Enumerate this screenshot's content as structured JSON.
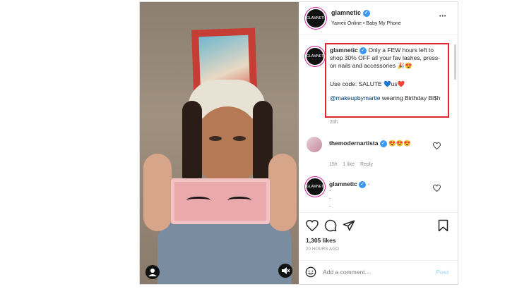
{
  "post": {
    "username": "glamnetic",
    "avatar_text": "GLAMNETIC",
    "music": "Yameii Online • Baby My Phone",
    "more_glyph": "•••"
  },
  "caption": {
    "username": "glamnetic",
    "text1": "Only a FEW hours left to shop 30% OFF all your fav lashes, press-on nails and accessories 🎉😍",
    "text2": "Use code: SALUTE 💙us❤️",
    "mention": "@makeupbymartie",
    "text3": " wearing Birthday Bi$h",
    "time": "20h"
  },
  "comments": [
    {
      "username": "themodernartista",
      "text": "😍😍😍",
      "time": "15h",
      "likes": "1 like",
      "reply": "Reply"
    },
    {
      "username": "glamnetic",
      "text": "•",
      "lines": [
        ".",
        ".",
        "."
      ]
    }
  ],
  "footer": {
    "likes": "1,305 likes",
    "time": "20 HOURS AGO",
    "comment_placeholder": "Add a comment...",
    "post_label": "Post"
  },
  "colors": {
    "highlight_border": "#e0242d",
    "link": "#00376b",
    "post_button": "#b2dffc"
  }
}
